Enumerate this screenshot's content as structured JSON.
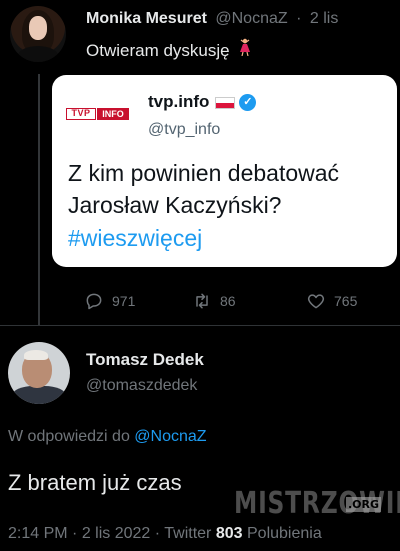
{
  "tweet": {
    "name": "Monika Mesuret",
    "handle": "@NocnaZ",
    "separator": "·",
    "time": "2 lis",
    "text": "Otwieram dyskusję",
    "emoji": "dancer-emoji"
  },
  "quote": {
    "logo": {
      "left": "TVP",
      "right": "INFO"
    },
    "name": "tvp.info",
    "flag": "poland-flag-icon",
    "verified": "✓",
    "handle": "@tvp_info",
    "text": "Z kim powinien debatować Jarosław Kaczyński?",
    "hashtag": "#wieszwięcej"
  },
  "actions": {
    "replies": "971",
    "retweets": "86",
    "likes": "765"
  },
  "reply": {
    "name": "Tomasz Dedek",
    "handle": "@tomaszdedek",
    "replying_prefix": "W odpowiedzi do",
    "replying_to": "@NocnaZ",
    "text": "Z bratem już czas",
    "time": "2:14 PM",
    "sep1": "·",
    "date": "2 lis 2022",
    "sep2": "·",
    "source": "Twitter",
    "likes_count": "803",
    "likes_label": "Polubienia"
  },
  "watermark": {
    "text": "MISTRZOWIE",
    "suffix": ".ORG"
  },
  "colors": {
    "background": "#000000",
    "accent": "#1d9bf0",
    "muted": "#71767b",
    "tvp_red": "#c8102e"
  }
}
